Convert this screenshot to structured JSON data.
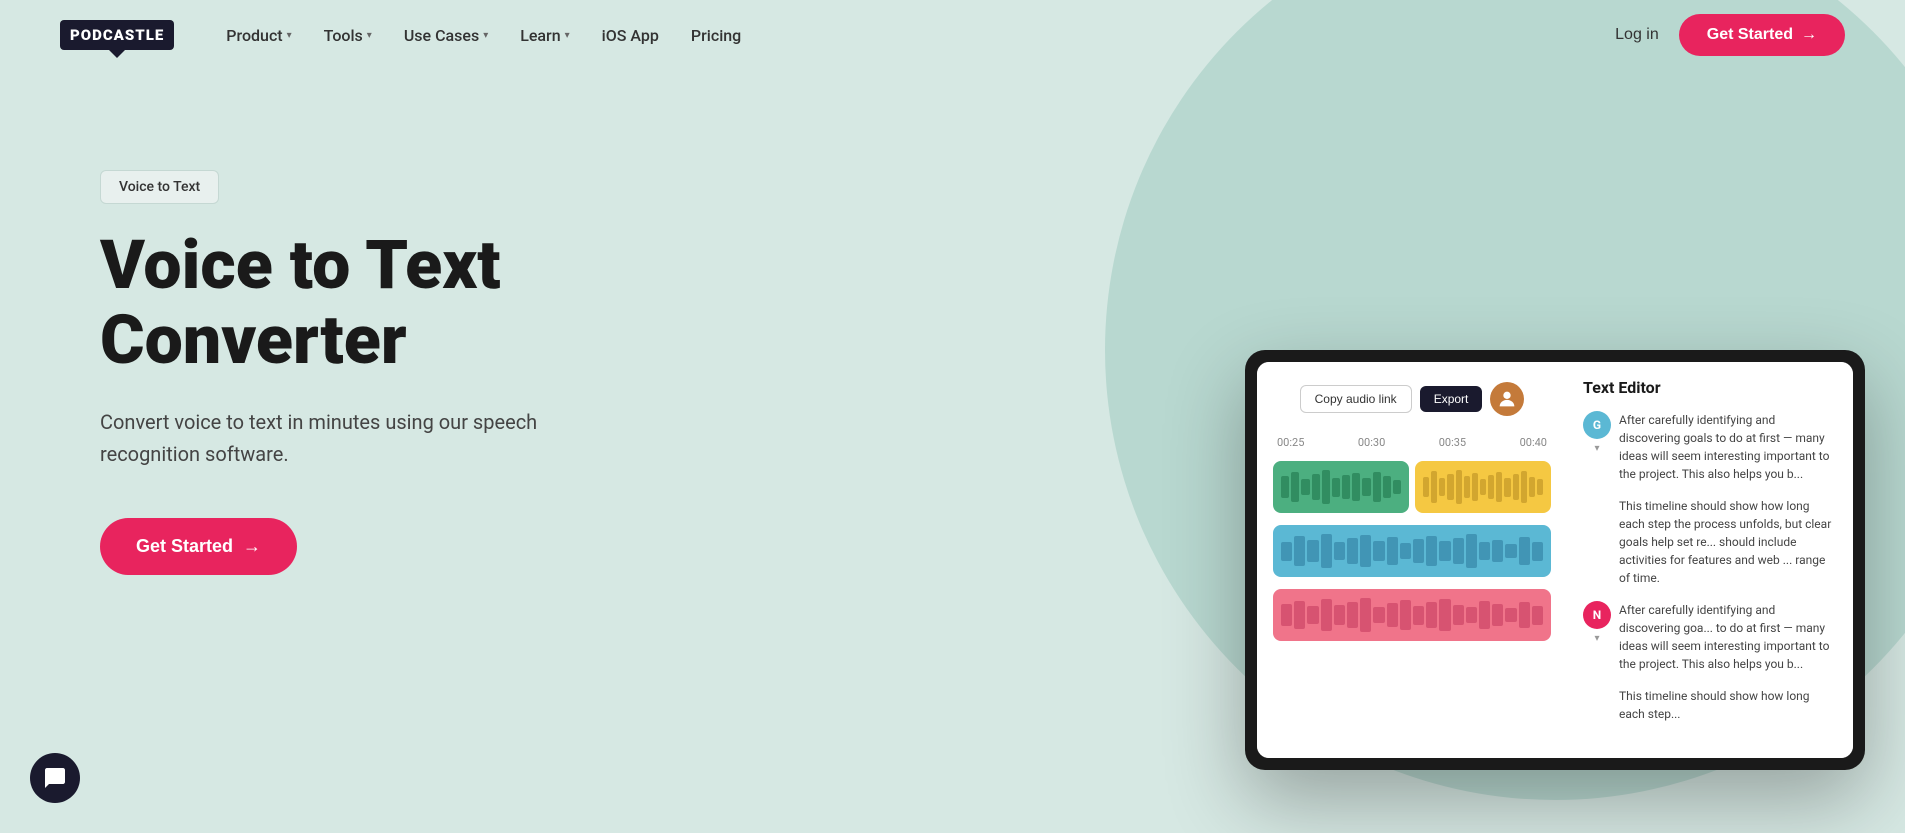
{
  "brand": {
    "name": "PODCASTLE",
    "logo_symbol": "🎙"
  },
  "nav": {
    "items": [
      {
        "id": "product",
        "label": "Product",
        "has_dropdown": true
      },
      {
        "id": "tools",
        "label": "Tools",
        "has_dropdown": true
      },
      {
        "id": "use-cases",
        "label": "Use Cases",
        "has_dropdown": true
      },
      {
        "id": "learn",
        "label": "Learn",
        "has_dropdown": true
      },
      {
        "id": "ios-app",
        "label": "iOS App",
        "has_dropdown": false
      },
      {
        "id": "pricing",
        "label": "Pricing",
        "has_dropdown": false
      }
    ],
    "login_label": "Log in",
    "get_started_label": "Get Started",
    "get_started_arrow": "→"
  },
  "hero": {
    "badge": "Voice to Text",
    "title_line1": "Voice to Text",
    "title_line2": "Converter",
    "subtitle": "Convert voice to text in minutes using our speech recognition software.",
    "cta_label": "Get Started",
    "cta_arrow": "→"
  },
  "tablet": {
    "toolbar": {
      "copy_btn": "Copy audio link",
      "export_btn": "Export"
    },
    "time_labels": [
      "00:25",
      "00:30",
      "00:35",
      "00:40"
    ],
    "text_editor": {
      "title": "Text Editor",
      "blocks": [
        {
          "id": "G",
          "color": "g",
          "text": "After carefully identifying and discovering goals to do at first — many ideas will seem interesting important to the project. This also helps you b..."
        },
        {
          "id": "G",
          "color": "g",
          "text": "This timeline should show how long each step the process unfolds, but clear goals help set re... should include activities for features and web ... range of time."
        },
        {
          "id": "N",
          "color": "n",
          "text": "After carefully identifying and discovering goa... to do at first — many ideas will seem interesting important to the project. This also helps you b..."
        },
        {
          "id": "N",
          "color": "n",
          "text": "This timeline should show how long each step..."
        }
      ]
    }
  },
  "chat": {
    "icon_label": "chat-bubble"
  },
  "colors": {
    "brand_red": "#e8245e",
    "dark": "#1a1a2e",
    "bg_light": "#d6e8e3",
    "bg_circle": "#b8d8d0"
  }
}
